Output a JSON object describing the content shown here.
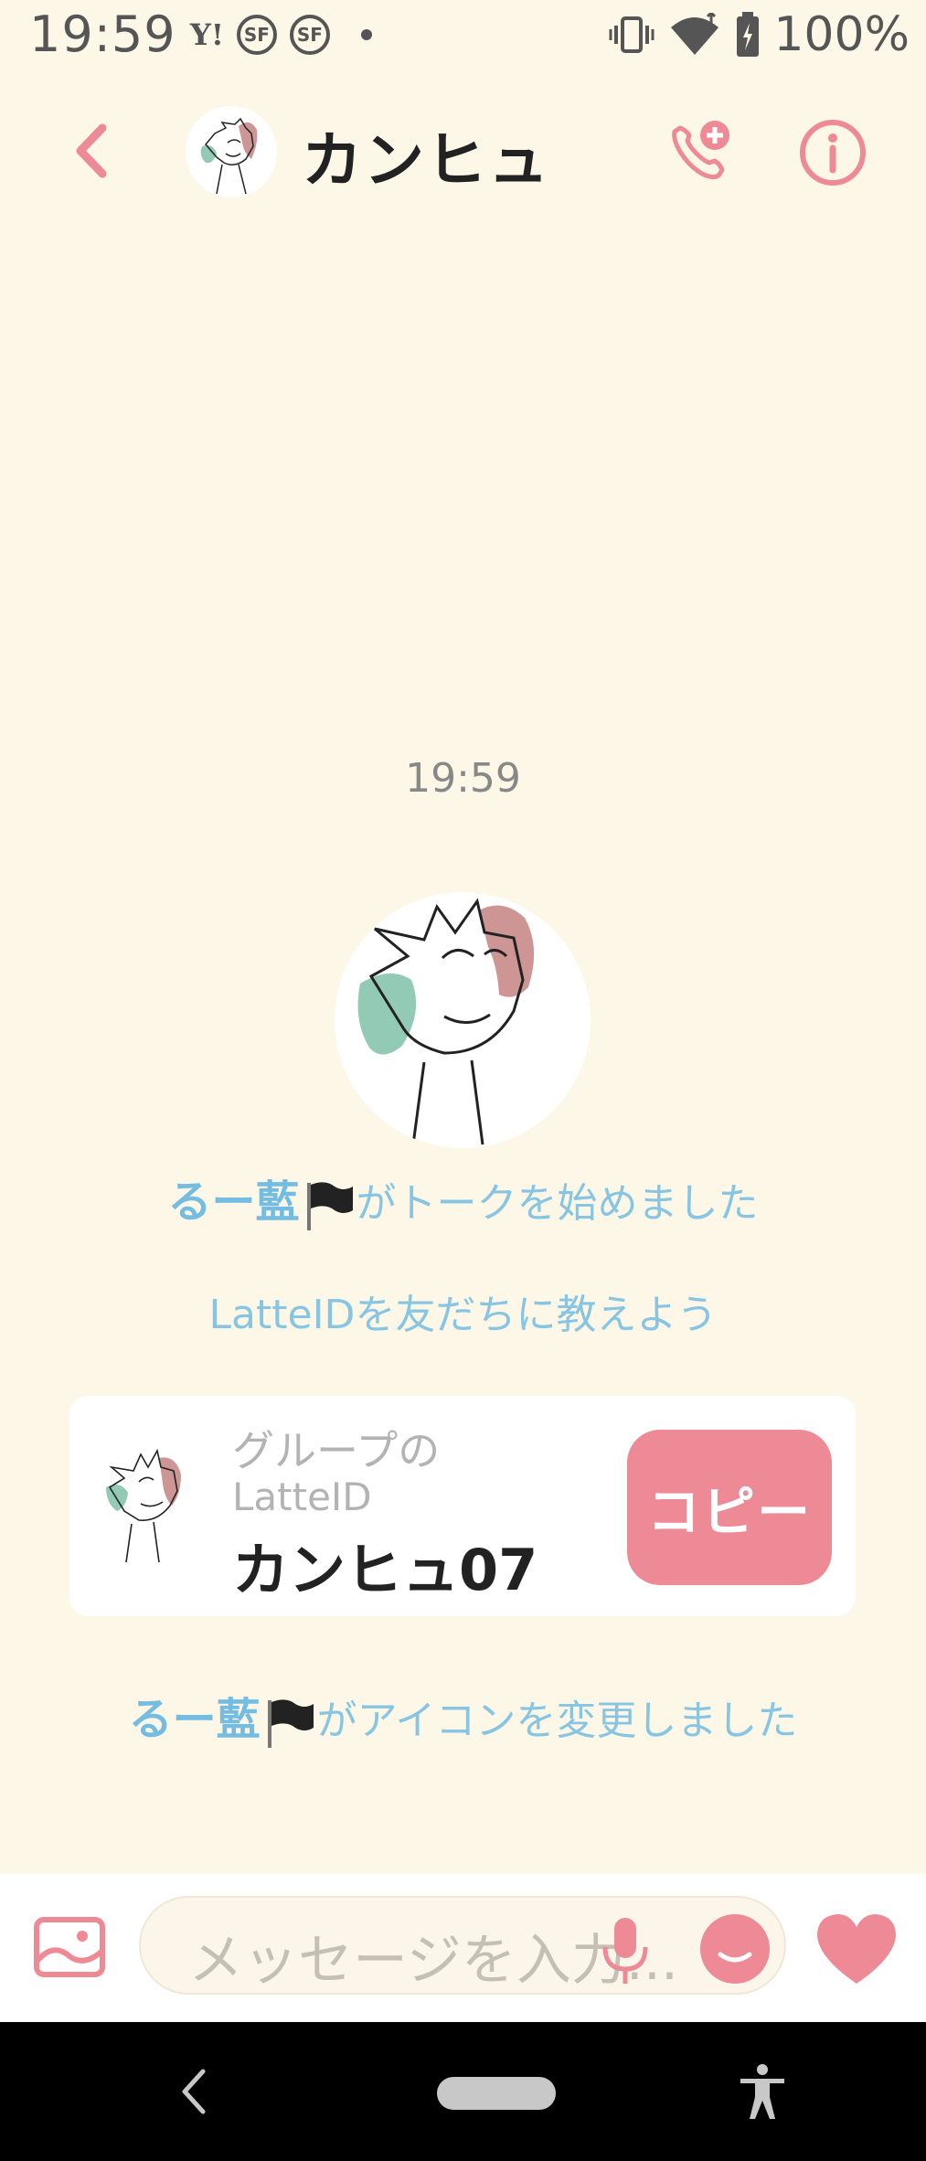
{
  "status_bar": {
    "time": "19:59",
    "yahoo": "Y!",
    "sf1": "SF",
    "sf2": "SF",
    "battery": "100%",
    "icons": [
      "vibrate-icon",
      "wifi-icon",
      "battery-charging-icon"
    ]
  },
  "header": {
    "title": "カンヒュ",
    "icons": [
      "back-icon",
      "add-call-icon",
      "info-icon"
    ]
  },
  "chat": {
    "timestamp": "19:59",
    "msg1": {
      "name": "るー藍",
      "text": "がトークを始めました"
    },
    "msg2": "LatteIDを友だちに教えよう",
    "id_card": {
      "label1": "グループの",
      "label2": "LatteID",
      "id": "カンヒュ07",
      "copy_label": "コピー"
    },
    "msg3": {
      "name": "るー藍",
      "text": "がアイコンを変更しました"
    }
  },
  "input_bar": {
    "placeholder": "メッセージを入力...",
    "icons": [
      "image-icon",
      "mic-icon",
      "emoji-icon",
      "heart-icon"
    ]
  },
  "colors": {
    "background": "#fdf7e8",
    "accent": "#ee8a96",
    "system_text": "#87c5e3"
  }
}
